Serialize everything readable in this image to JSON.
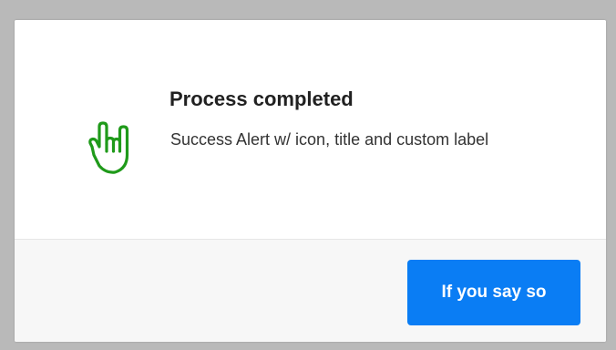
{
  "alert": {
    "variant": "success",
    "icon": "rock-on-hand-icon",
    "icon_color": "#1f9a1a",
    "title": "Process completed",
    "message": "Success Alert w/ icon, title and custom label"
  },
  "actions": {
    "confirm_label": "If you say so",
    "confirm_color": "#0a7df4"
  }
}
